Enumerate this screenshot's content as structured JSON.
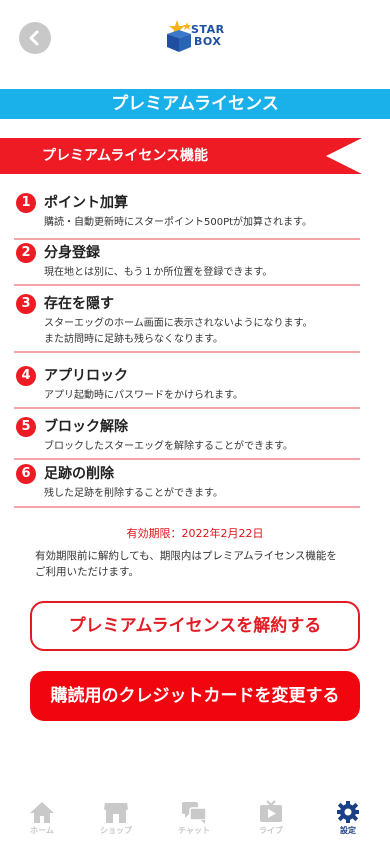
{
  "header": {
    "logo_line1": "STAR",
    "logo_line2": "BOX"
  },
  "page_title": "プレミアムライセンス",
  "section": {
    "title": "プレミアムライセンス機能"
  },
  "features": [
    {
      "num": "1",
      "title": "ポイント加算",
      "desc": "購読・自動更新時にスターポイント500Ptが加算されます。"
    },
    {
      "num": "2",
      "title": "分身登録",
      "desc": "現在地とは別に、もう１か所位置を登録できます。"
    },
    {
      "num": "3",
      "title": "存在を隠す",
      "desc": "スターエッグのホーム画面に表示されないようになります。\nまた訪問時に足跡も残らなくなります。"
    },
    {
      "num": "4",
      "title": "アプリロック",
      "desc": "アプリ起動時にパスワードをかけられます。"
    },
    {
      "num": "5",
      "title": "ブロック解除",
      "desc": "ブロックしたスターエッグを解除することができます。"
    },
    {
      "num": "6",
      "title": "足跡の削除",
      "desc": "残した足跡を削除することができます。"
    }
  ],
  "expiry": "有効期限：2022年2月22日",
  "notice": "有効期限前に解約しても、期限内はプレミアムライセンス機能を\nご利用いただけます。",
  "buttons": {
    "cancel_label": "プレミアムライセンスを解約する",
    "change_card_label": "購読用のクレジットカードを変更する"
  },
  "tabs": [
    {
      "label": "ホーム",
      "icon": "home-icon"
    },
    {
      "label": "ショップ",
      "icon": "shop-icon"
    },
    {
      "label": "チャット",
      "icon": "chat-icon"
    },
    {
      "label": "ライブ",
      "icon": "live-icon"
    },
    {
      "label": "設定",
      "icon": "gear-icon",
      "active": true
    }
  ],
  "colors": {
    "accent_red": "#ee1b24",
    "title_blue": "#1ab0ea",
    "active_tab": "#1a3f86",
    "inactive_tab": "#c9c9c9"
  }
}
